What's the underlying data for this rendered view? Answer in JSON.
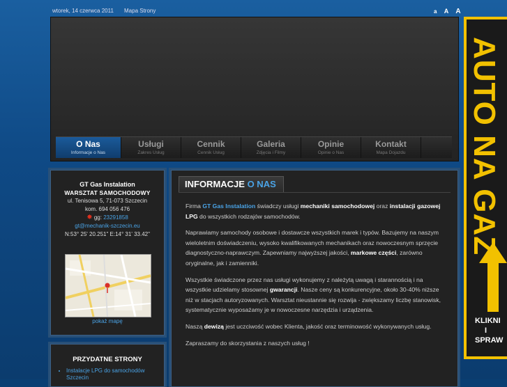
{
  "topbar": {
    "date": "wtorek, 14 czerwca 2011",
    "sitemap": "Mapa Strony",
    "font_sizes": [
      "a",
      "A",
      "A"
    ]
  },
  "nav": [
    {
      "title": "O Nas",
      "sub": "Informacje o Nas"
    },
    {
      "title": "Usługi",
      "sub": "Zakres Usług"
    },
    {
      "title": "Cennik",
      "sub": "Cennik Usług"
    },
    {
      "title": "Galeria",
      "sub": "Zdjęcia i Filmy"
    },
    {
      "title": "Opinie",
      "sub": "Opinie o Nas"
    },
    {
      "title": "Kontakt",
      "sub": "Mapa Dojazdu"
    }
  ],
  "contact": {
    "company": "GT Gas Instalation",
    "workshop": "WARSZTAT SAMOCHODOWY",
    "address": "ul. Tenisowa 5, 71-073 Szczecin",
    "phone": "kom. 694 056 476",
    "gg_label": "gg:",
    "gg_number": "23291858",
    "email": "gt@mechanik-szczecin.eu",
    "coords": "N:53° 25' 20.251\" E:14° 31' 33.42\"",
    "show_map": "pokaż mapę"
  },
  "useful": {
    "title": "PRZYDATNE STRONY",
    "links": [
      "Instalacje LPG do samochodów Szczecin"
    ]
  },
  "main": {
    "title_a": "INFORMACJE",
    "title_b": "O NAS",
    "p1": [
      "Firma ",
      "GT Gas Instalation",
      " świadczy usługi ",
      "mechaniki samochodowej",
      " oraz ",
      "instalacji gazowej LPG",
      " do wszystkich rodzajów samochodów."
    ],
    "p2": [
      "Naprawiamy samochody osobowe i dostawcze wszystkich marek i typów. Bazujemy na naszym wieloletnim doświadczeniu, wysoko kwalifikowanych mechanikach oraz nowoczesnym sprzęcie diagnostyczno-naprawczym. Zapewniamy najwyższej jakości, ",
      "markowe części",
      ", zarówno oryginalne, jak i zamienniki."
    ],
    "p3": [
      "Wszystkie świadczone przez nas usługi wykonujemy z należytą uwagą i starannością i na wszystkie udzielamy stosownej ",
      "gwarancji",
      ". Nasze ceny są konkurencyjne, około 30-40% niższe niż w stacjach autoryzowanych. Warsztat nieustannie się rozwija - zwiększamy liczbę stanowisk, systematycznie wyposażamy je w nowoczesne narzędzia i urządzenia."
    ],
    "p4": [
      "Naszą ",
      "dewizą",
      " jest uczciwość wobec Klienta, jakość oraz terminowość wykonywanych usług."
    ],
    "p5": "Zapraszamy do skorzystania z naszych usług !"
  },
  "banner": {
    "vertical": "AUTO NA GAZ",
    "lines": [
      "KLIKNI",
      "I",
      "SPRAW"
    ]
  },
  "colors": {
    "accent": "#4aa3e6",
    "banner_yellow": "#f2c100",
    "bg_blue": "#0f4a86"
  }
}
